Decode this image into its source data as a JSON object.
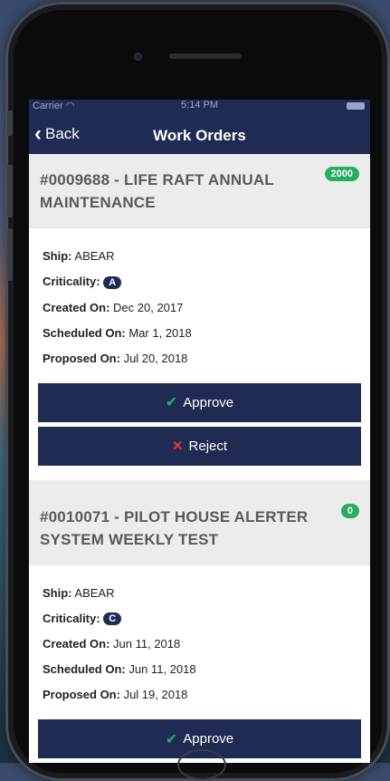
{
  "status": {
    "carrier": "Carrier",
    "time": "5:14 PM"
  },
  "nav": {
    "back_label": "Back",
    "title": "Work Orders"
  },
  "labels": {
    "ship": "Ship:",
    "criticality": "Criticality:",
    "created": "Created On:",
    "scheduled": "Scheduled On:",
    "proposed": "Proposed On:",
    "approve": "Approve",
    "reject": "Reject"
  },
  "orders": [
    {
      "title": "#0009688 - LIFE RAFT ANNUAL MAINTENANCE",
      "badge": "2000",
      "ship": "ABEAR",
      "criticality": "A",
      "created": "Dec 20, 2017",
      "scheduled": "Mar 1, 2018",
      "proposed": "Jul 20, 2018"
    },
    {
      "title": "#0010071 - PILOT HOUSE ALERTER SYSTEM WEEKLY TEST",
      "badge": "0",
      "ship": "ABEAR",
      "criticality": "C",
      "created": "Jun 11, 2018",
      "scheduled": "Jun 11, 2018",
      "proposed": "Jul 19, 2018"
    }
  ],
  "colors": {
    "navy": "#1f2b52",
    "green": "#27ae60",
    "red": "#e0353f"
  },
  "icons": {
    "back": "chevron-left-icon",
    "approve": "checkmark-icon",
    "reject": "x-icon"
  }
}
